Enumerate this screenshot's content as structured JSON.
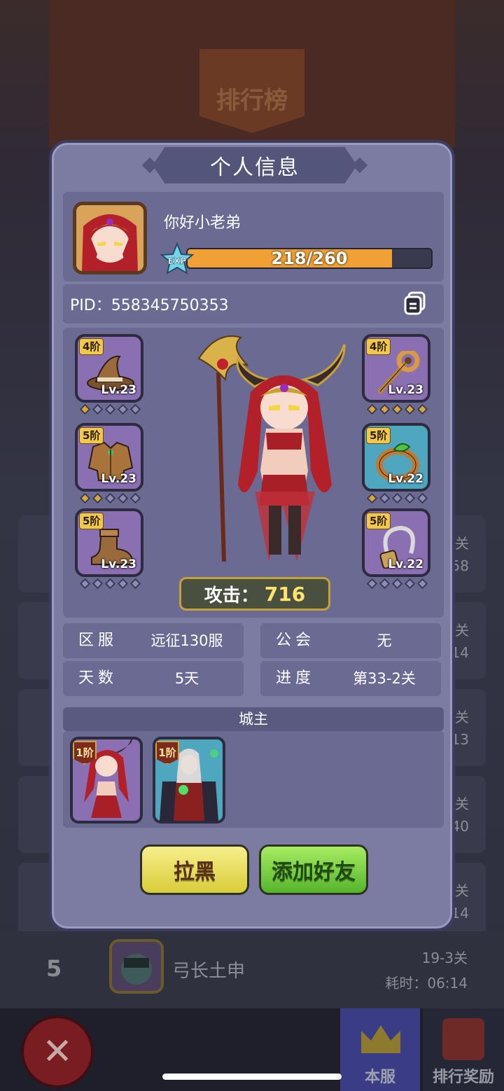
{
  "background": {
    "title": "排行榜",
    "row5": {
      "rank": "5",
      "name": "弓长土申",
      "level": "19-3关",
      "time": "耗时：06:14"
    },
    "side_texts": [
      "关",
      "58",
      "关",
      "14",
      "关",
      "13",
      "关",
      "40",
      "关",
      "14"
    ],
    "close_icon": "close-x-icon",
    "tabs": [
      {
        "label": "本服",
        "icon": "crown-icon"
      },
      {
        "label": "排行奖励",
        "icon": "trophy-icon"
      }
    ]
  },
  "modal": {
    "title": "个人信息",
    "player": {
      "name": "你好小老弟",
      "exp_label": "EXP",
      "exp_text": "218/260",
      "exp_fraction": 0.838,
      "pid": "PID：558345750353",
      "copy_icon": "copy-icon"
    },
    "equipment": [
      {
        "tier": "4阶",
        "level": "Lv.23",
        "icon": "wizard-hat-icon",
        "gems_on": 1,
        "gems": 5
      },
      {
        "tier": "5阶",
        "level": "Lv.23",
        "icon": "armor-icon",
        "gems_on": 2,
        "gems": 5
      },
      {
        "tier": "5阶",
        "level": "Lv.23",
        "icon": "boot-icon",
        "gems_on": 0,
        "gems": 5
      },
      {
        "tier": "4阶",
        "level": "Lv.23",
        "icon": "staff-icon",
        "gems_on": 5,
        "gems": 5
      },
      {
        "tier": "5阶",
        "level": "Lv.22",
        "icon": "ring-icon",
        "gems_on": 1,
        "gems": 5
      },
      {
        "tier": "5阶",
        "level": "Lv.22",
        "icon": "necklace-icon",
        "gems_on": 0,
        "gems": 5
      }
    ],
    "attack": {
      "label": "攻击：",
      "value": "716"
    },
    "info": [
      {
        "label": "区服",
        "value": "远征130服"
      },
      {
        "label": "公会",
        "value": "无"
      },
      {
        "label": "天数",
        "value": "5天"
      },
      {
        "label": "进度",
        "value": "第33-2关"
      }
    ],
    "city": {
      "title": "城主",
      "heroes": [
        {
          "tier": "1阶",
          "name": "succubus-hero"
        },
        {
          "tier": "1阶",
          "name": "vampire-lord-hero"
        }
      ]
    },
    "buttons": {
      "block": "拉黑",
      "add_friend": "添加好友"
    }
  },
  "colors": {
    "modal_bg": "#7c7ca3",
    "panel": "#6a6a93",
    "exp_fill": "#f0a034",
    "btn_yellow": "#e8de5a",
    "btn_green": "#7bd443"
  }
}
